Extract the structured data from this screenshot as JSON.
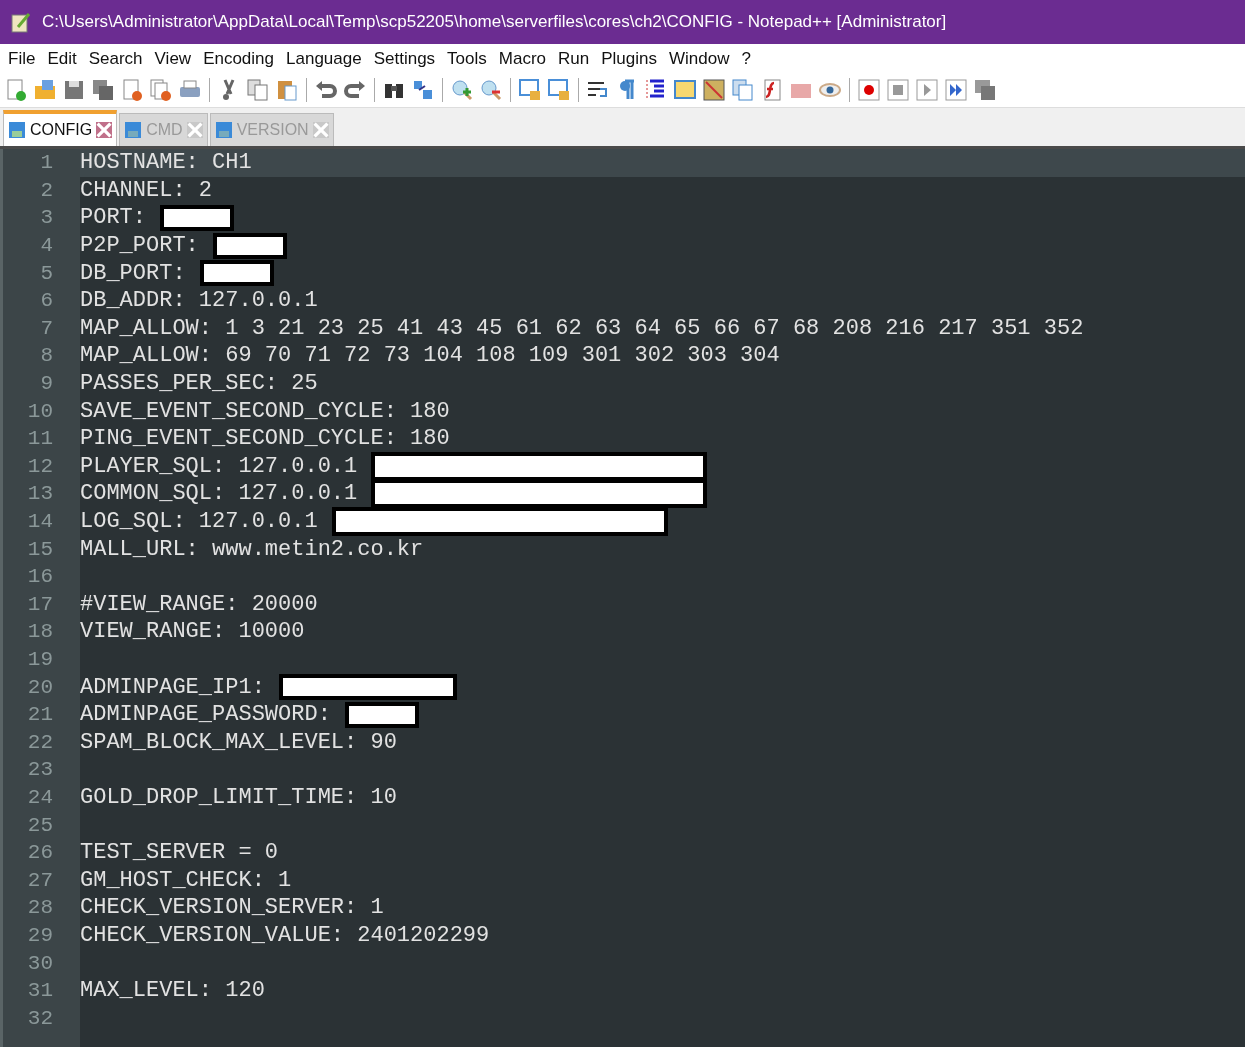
{
  "window": {
    "title": "C:\\Users\\Administrator\\AppData\\Local\\Temp\\scp52205\\home\\serverfiles\\cores\\ch2\\CONFIG - Notepad++ [Administrator]"
  },
  "menu": [
    "File",
    "Edit",
    "Search",
    "View",
    "Encoding",
    "Language",
    "Settings",
    "Tools",
    "Macro",
    "Run",
    "Plugins",
    "Window",
    "?"
  ],
  "tabs": [
    {
      "label": "CONFIG",
      "selected": true
    },
    {
      "label": "CMD",
      "selected": false
    },
    {
      "label": "VERSION",
      "selected": false
    }
  ],
  "lines": [
    {
      "number": "1",
      "text": "HOSTNAME: CH1",
      "current": true
    },
    {
      "number": "2",
      "text": "CHANNEL: 2",
      "current": false
    },
    {
      "number": "3",
      "text": "PORT:",
      "current": false,
      "redaction": {
        "kind": "short"
      }
    },
    {
      "number": "4",
      "text": "P2P_PORT:",
      "current": false,
      "redaction": {
        "kind": "short"
      }
    },
    {
      "number": "5",
      "text": "DB_PORT:",
      "current": false,
      "redaction": {
        "kind": "short"
      }
    },
    {
      "number": "6",
      "text": "DB_ADDR: 127.0.0.1",
      "current": false
    },
    {
      "number": "7",
      "text": "MAP_ALLOW: 1 3 21 23 25 41 43 45 61 62 63 64 65 66 67 68 208 216 217 351 352",
      "current": false
    },
    {
      "number": "8",
      "text": "MAP_ALLOW: 69 70 71 72 73 104 108 109 301 302 303 304",
      "current": false
    },
    {
      "number": "9",
      "text": "PASSES_PER_SEC: 25",
      "current": false
    },
    {
      "number": "10",
      "text": "SAVE_EVENT_SECOND_CYCLE: 180",
      "current": false
    },
    {
      "number": "11",
      "text": "PING_EVENT_SECOND_CYCLE: 180",
      "current": false
    },
    {
      "number": "12",
      "text": "PLAYER_SQL: 127.0.0.1",
      "current": false,
      "redaction": {
        "kind": "wide"
      }
    },
    {
      "number": "13",
      "text": "COMMON_SQL: 127.0.0.1",
      "current": false,
      "redaction": {
        "kind": "wide"
      }
    },
    {
      "number": "14",
      "text": "LOG_SQL: 127.0.0.1",
      "current": false,
      "redaction": {
        "kind": "wide"
      }
    },
    {
      "number": "15",
      "text": "MALL_URL: www.metin2.co.kr",
      "current": false
    },
    {
      "number": "16",
      "current": false
    },
    {
      "number": "17",
      "text": "#VIEW_RANGE: 20000",
      "current": false
    },
    {
      "number": "18",
      "text": "VIEW_RANGE: 10000",
      "current": false
    },
    {
      "number": "19",
      "current": false
    },
    {
      "number": "20",
      "text": "ADMINPAGE_IP1:",
      "current": false,
      "redaction": {
        "kind": "medium"
      }
    },
    {
      "number": "21",
      "text": "ADMINPAGE_PASSWORD:",
      "current": false,
      "redaction": {
        "kind": "short"
      }
    },
    {
      "number": "22",
      "text": "SPAM_BLOCK_MAX_LEVEL: 90",
      "current": false
    },
    {
      "number": "23",
      "current": false
    },
    {
      "number": "24",
      "text": "GOLD_DROP_LIMIT_TIME: 10",
      "current": false
    },
    {
      "number": "25",
      "current": false
    },
    {
      "number": "26",
      "text": "TEST_SERVER = 0",
      "current": false
    },
    {
      "number": "27",
      "text": "GM_HOST_CHECK: 1",
      "current": false
    },
    {
      "number": "28",
      "text": "CHECK_VERSION_SERVER: 1",
      "current": false
    },
    {
      "number": "29",
      "text": "CHECK_VERSION_VALUE: 2401202299",
      "current": false
    },
    {
      "number": "30",
      "current": false
    },
    {
      "number": "31",
      "text": "MAX_LEVEL: 120",
      "current": false
    },
    {
      "number": "32",
      "current": false
    }
  ]
}
